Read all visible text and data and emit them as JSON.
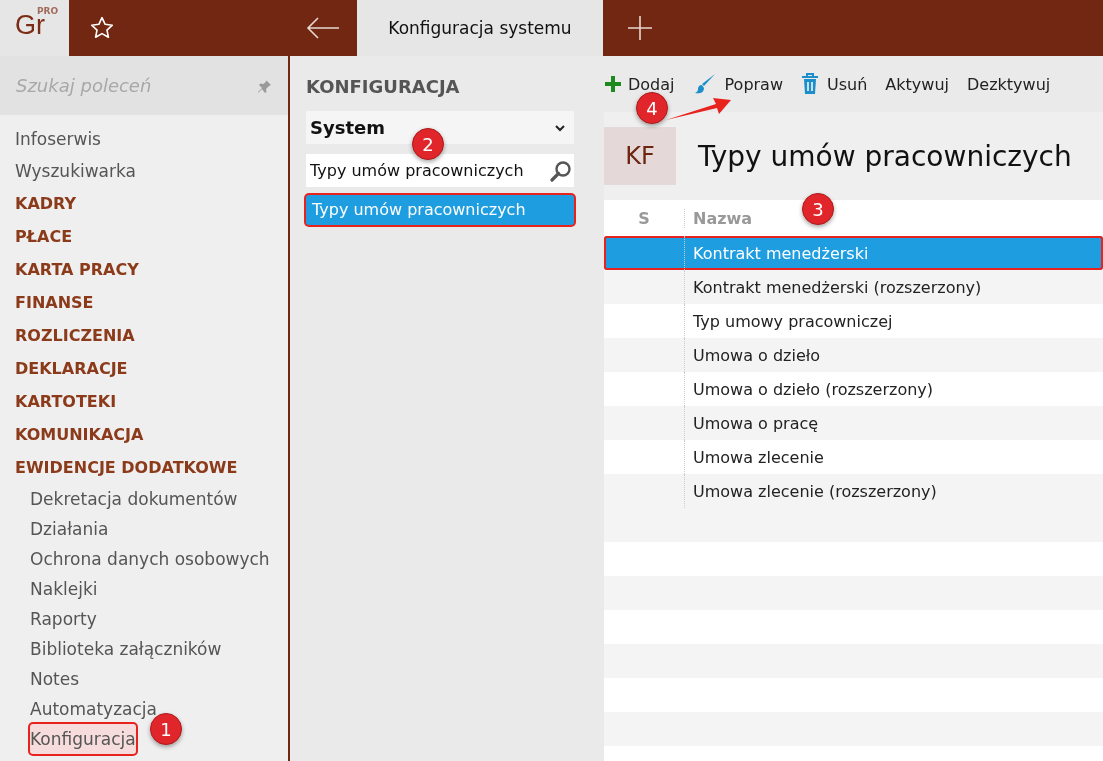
{
  "logo": {
    "text": "Gr",
    "badge": "PRO"
  },
  "tabs": [
    {
      "label": "Konfiguracja systemu",
      "selected": true
    }
  ],
  "sidebar": {
    "search": {
      "placeholder": "Szukaj poleceń"
    },
    "items": [
      {
        "label": "Infoserwis",
        "kind": "link",
        "annotated": false
      },
      {
        "label": "Wyszukiwarka",
        "kind": "link",
        "annotated": false
      },
      {
        "label": "KADRY",
        "kind": "section",
        "annotated": false
      },
      {
        "label": "PŁACE",
        "kind": "section",
        "annotated": false
      },
      {
        "label": "KARTA PRACY",
        "kind": "section",
        "annotated": false
      },
      {
        "label": "FINANSE",
        "kind": "section",
        "annotated": false
      },
      {
        "label": "ROZLICZENIA",
        "kind": "section",
        "annotated": false
      },
      {
        "label": "DEKLARACJE",
        "kind": "section",
        "annotated": false
      },
      {
        "label": "KARTOTEKI",
        "kind": "section",
        "annotated": false
      },
      {
        "label": "KOMUNIKACJA",
        "kind": "section",
        "annotated": false
      },
      {
        "label": "EWIDENCJE DODATKOWE",
        "kind": "section",
        "annotated": false
      },
      {
        "label": "Dekretacja dokumentów",
        "kind": "sub",
        "annotated": false
      },
      {
        "label": "Działania",
        "kind": "sub",
        "annotated": false
      },
      {
        "label": "Ochrona danych osobowych",
        "kind": "sub",
        "annotated": false
      },
      {
        "label": "Naklejki",
        "kind": "sub",
        "annotated": false
      },
      {
        "label": "Raporty",
        "kind": "sub",
        "annotated": false
      },
      {
        "label": "Biblioteka załączników",
        "kind": "sub",
        "annotated": false
      },
      {
        "label": "Notes",
        "kind": "sub",
        "annotated": false
      },
      {
        "label": "Automatyzacja",
        "kind": "sub",
        "annotated": false
      },
      {
        "label": "Konfiguracja",
        "kind": "sub",
        "annotated": true
      }
    ]
  },
  "config": {
    "title": "KONFIGURACJA",
    "dropdown": "System",
    "filter": {
      "value": "Typy umów pracowniczych"
    },
    "items": [
      {
        "label": "Typy umów pracowniczych",
        "selected": true,
        "annotated": true
      }
    ]
  },
  "toolbar": [
    {
      "label": "Dodaj",
      "kind": "add"
    },
    {
      "label": "Popraw",
      "kind": "edit"
    },
    {
      "label": "Usuń",
      "kind": "delete"
    },
    {
      "label": "Aktywuj",
      "kind": "text"
    },
    {
      "label": "Dezktywuj",
      "kind": "text"
    }
  ],
  "header": {
    "badge": "KF",
    "title": "Typy umów pracowniczych"
  },
  "table": {
    "columns": [
      "S",
      "Nazwa"
    ],
    "rows": [
      {
        "name": "Kontrakt menedżerski",
        "selected": true,
        "annotated": true
      },
      {
        "name": "Kontrakt menedżerski (rozszerzony)",
        "selected": false,
        "annotated": false
      },
      {
        "name": "Typ umowy pracowniczej",
        "selected": false,
        "annotated": false
      },
      {
        "name": "Umowa o dzieło",
        "selected": false,
        "annotated": false
      },
      {
        "name": "Umowa o dzieło (rozszerzony)",
        "selected": false,
        "annotated": false
      },
      {
        "name": "Umowa o pracę",
        "selected": false,
        "annotated": false
      },
      {
        "name": "Umowa zlecenie",
        "selected": false,
        "annotated": false
      },
      {
        "name": "Umowa zlecenie (rozszerzony)",
        "selected": false,
        "annotated": false
      }
    ]
  },
  "callouts": [
    {
      "label": "1"
    },
    {
      "label": "2"
    },
    {
      "label": "3"
    },
    {
      "label": "4"
    }
  ]
}
